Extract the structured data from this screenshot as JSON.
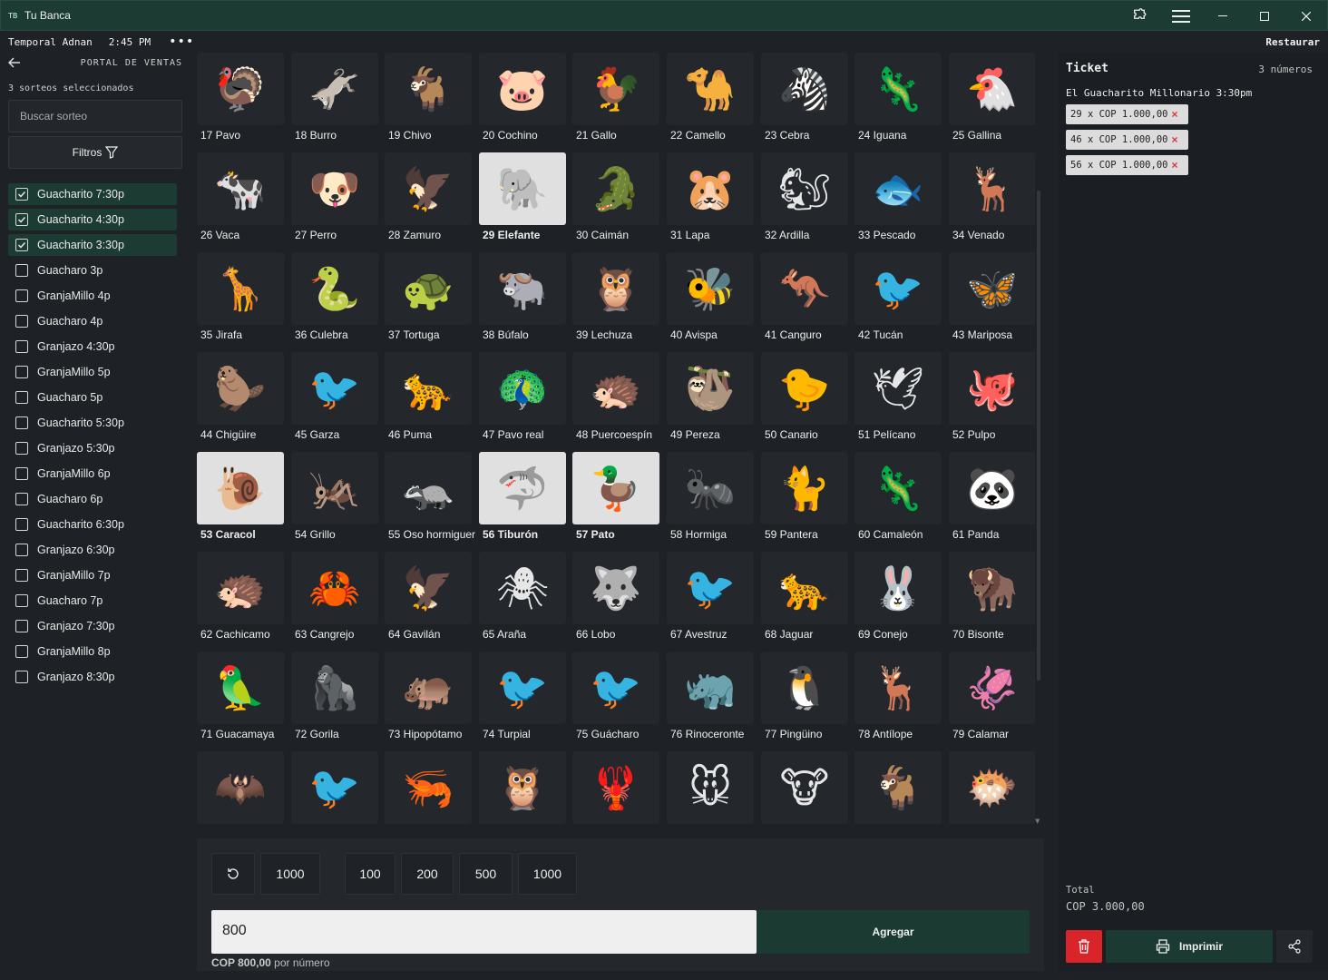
{
  "window": {
    "app_icon": "TB",
    "title": "Tu Banca"
  },
  "status": {
    "user": "Temporal Adnan",
    "time": "2:45 PM",
    "more": "•••",
    "restore": "Restaurar"
  },
  "sidebar": {
    "portal": "PORTAL DE VENTAS",
    "selected_count": "3 sorteos seleccionados",
    "search_placeholder": "Buscar sorteo",
    "filters": "Filtros",
    "draws": [
      {
        "label": "Guacharito 7:30p",
        "checked": true
      },
      {
        "label": "Guacharito 4:30p",
        "checked": true
      },
      {
        "label": "Guacharito 3:30p",
        "checked": true
      },
      {
        "label": "Guacharo 3p",
        "checked": false
      },
      {
        "label": "GranjaMillo 4p",
        "checked": false
      },
      {
        "label": "Guacharo 4p",
        "checked": false
      },
      {
        "label": "Granjazo 4:30p",
        "checked": false
      },
      {
        "label": "GranjaMillo 5p",
        "checked": false
      },
      {
        "label": "Guacharo 5p",
        "checked": false
      },
      {
        "label": "Guacharito 5:30p",
        "checked": false
      },
      {
        "label": "Granjazo 5:30p",
        "checked": false
      },
      {
        "label": "GranjaMillo 6p",
        "checked": false
      },
      {
        "label": "Guacharo 6p",
        "checked": false
      },
      {
        "label": "Guacharito 6:30p",
        "checked": false
      },
      {
        "label": "Granjazo 6:30p",
        "checked": false
      },
      {
        "label": "GranjaMillo 7p",
        "checked": false
      },
      {
        "label": "Guacharo 7p",
        "checked": false
      },
      {
        "label": "Granjazo 7:30p",
        "checked": false
      },
      {
        "label": "GranjaMillo 8p",
        "checked": false
      },
      {
        "label": "Granjazo 8:30p",
        "checked": false
      }
    ]
  },
  "animals": [
    {
      "label": "17 Pavo",
      "emoji": "🦃",
      "selected": false
    },
    {
      "label": "18 Burro",
      "emoji": "🫏",
      "selected": false
    },
    {
      "label": "19 Chivo",
      "emoji": "🐐",
      "selected": false
    },
    {
      "label": "20 Cochino",
      "emoji": "🐷",
      "selected": false
    },
    {
      "label": "21 Gallo",
      "emoji": "🐓",
      "selected": false
    },
    {
      "label": "22 Camello",
      "emoji": "🐪",
      "selected": false
    },
    {
      "label": "23 Cebra",
      "emoji": "🦓",
      "selected": false
    },
    {
      "label": "24 Iguana",
      "emoji": "🦎",
      "selected": false
    },
    {
      "label": "25 Gallina",
      "emoji": "🐔",
      "selected": false
    },
    {
      "label": "26 Vaca",
      "emoji": "🐄",
      "selected": false
    },
    {
      "label": "27 Perro",
      "emoji": "🐶",
      "selected": false
    },
    {
      "label": "28 Zamuro",
      "emoji": "🦅",
      "selected": false
    },
    {
      "label": "29 Elefante",
      "emoji": "🐘",
      "selected": true
    },
    {
      "label": "30 Caimán",
      "emoji": "🐊",
      "selected": false
    },
    {
      "label": "31 Lapa",
      "emoji": "🐹",
      "selected": false
    },
    {
      "label": "32 Ardilla",
      "emoji": "🐿",
      "selected": false
    },
    {
      "label": "33 Pescado",
      "emoji": "🐟",
      "selected": false
    },
    {
      "label": "34 Venado",
      "emoji": "🦌",
      "selected": false
    },
    {
      "label": "35 Jirafa",
      "emoji": "🦒",
      "selected": false
    },
    {
      "label": "36 Culebra",
      "emoji": "🐍",
      "selected": false
    },
    {
      "label": "37 Tortuga",
      "emoji": "🐢",
      "selected": false
    },
    {
      "label": "38 Búfalo",
      "emoji": "🐃",
      "selected": false
    },
    {
      "label": "39 Lechuza",
      "emoji": "🦉",
      "selected": false
    },
    {
      "label": "40 Avispa",
      "emoji": "🐝",
      "selected": false
    },
    {
      "label": "41 Canguro",
      "emoji": "🦘",
      "selected": false
    },
    {
      "label": "42 Tucán",
      "emoji": "🐦",
      "selected": false
    },
    {
      "label": "43 Mariposa",
      "emoji": "🦋",
      "selected": false
    },
    {
      "label": "44 Chigüire",
      "emoji": "🦫",
      "selected": false
    },
    {
      "label": "45 Garza",
      "emoji": "🐦",
      "selected": false
    },
    {
      "label": "46 Puma",
      "emoji": "🐆",
      "selected": false
    },
    {
      "label": "47 Pavo real",
      "emoji": "🦚",
      "selected": false
    },
    {
      "label": "48 Puercoespín",
      "emoji": "🦔",
      "selected": false
    },
    {
      "label": "49 Pereza",
      "emoji": "🦥",
      "selected": false
    },
    {
      "label": "50 Canario",
      "emoji": "🐤",
      "selected": false
    },
    {
      "label": "51 Pelícano",
      "emoji": "🕊",
      "selected": false
    },
    {
      "label": "52 Pulpo",
      "emoji": "🐙",
      "selected": false
    },
    {
      "label": "53 Caracol",
      "emoji": "🐌",
      "selected": true
    },
    {
      "label": "54 Grillo",
      "emoji": "🦗",
      "selected": false
    },
    {
      "label": "55 Oso hormiguero",
      "emoji": "🦡",
      "selected": false
    },
    {
      "label": "56 Tiburón",
      "emoji": "🦈",
      "selected": true
    },
    {
      "label": "57 Pato",
      "emoji": "🦆",
      "selected": true
    },
    {
      "label": "58 Hormiga",
      "emoji": "🐜",
      "selected": false
    },
    {
      "label": "59 Pantera",
      "emoji": "🐈",
      "selected": false
    },
    {
      "label": "60 Camaleón",
      "emoji": "🦎",
      "selected": false
    },
    {
      "label": "61 Panda",
      "emoji": "🐼",
      "selected": false
    },
    {
      "label": "62 Cachicamo",
      "emoji": "🦔",
      "selected": false
    },
    {
      "label": "63 Cangrejo",
      "emoji": "🦀",
      "selected": false
    },
    {
      "label": "64 Gavilán",
      "emoji": "🦅",
      "selected": false
    },
    {
      "label": "65 Araña",
      "emoji": "🕷",
      "selected": false
    },
    {
      "label": "66 Lobo",
      "emoji": "🐺",
      "selected": false
    },
    {
      "label": "67 Avestruz",
      "emoji": "🐦",
      "selected": false
    },
    {
      "label": "68 Jaguar",
      "emoji": "🐆",
      "selected": false
    },
    {
      "label": "69 Conejo",
      "emoji": "🐰",
      "selected": false
    },
    {
      "label": "70 Bisonte",
      "emoji": "🦬",
      "selected": false
    },
    {
      "label": "71 Guacamaya",
      "emoji": "🦜",
      "selected": false
    },
    {
      "label": "72 Gorila",
      "emoji": "🦍",
      "selected": false
    },
    {
      "label": "73 Hipopótamo",
      "emoji": "🦛",
      "selected": false
    },
    {
      "label": "74 Turpial",
      "emoji": "🐦",
      "selected": false
    },
    {
      "label": "75 Guácharo",
      "emoji": "🐦",
      "selected": false
    },
    {
      "label": "76 Rinoceronte",
      "emoji": "🦏",
      "selected": false
    },
    {
      "label": "77 Pingüino",
      "emoji": "🐧",
      "selected": false
    },
    {
      "label": "78 Antílope",
      "emoji": "🦌",
      "selected": false
    },
    {
      "label": "79 Calamar",
      "emoji": "🦑",
      "selected": false
    },
    {
      "label": "",
      "emoji": "🦇",
      "selected": false
    },
    {
      "label": "",
      "emoji": "🐦",
      "selected": false
    },
    {
      "label": "",
      "emoji": "🦐",
      "selected": false
    },
    {
      "label": "",
      "emoji": "🦉",
      "selected": false
    },
    {
      "label": "",
      "emoji": "🦞",
      "selected": false
    },
    {
      "label": "",
      "emoji": "🐭",
      "selected": false
    },
    {
      "label": "",
      "emoji": "🐮",
      "selected": false
    },
    {
      "label": "",
      "emoji": "🐐",
      "selected": false
    },
    {
      "label": "",
      "emoji": "🐡",
      "selected": false
    }
  ],
  "amount": {
    "reset_icon": "refresh-icon",
    "last": "1000",
    "quick": [
      "100",
      "200",
      "500",
      "1000"
    ],
    "value": "800",
    "add": "Agregar",
    "per_number_value": "COP 800,00",
    "per_number_suffix": " por número"
  },
  "ticket": {
    "title": "Ticket",
    "count": "3 números",
    "draw": "El Guacharito Millonario 3:30pm",
    "lines": [
      "29 x COP 1.000,00",
      "46 x COP 1.000,00",
      "56 x COP 1.000,00"
    ],
    "remove_glyph": "×",
    "total_label": "Total",
    "total_value": "COP 3.000,00",
    "print": "Imprimir"
  },
  "colors": {
    "accent": "#1b3b32",
    "danger": "#d9252a",
    "background": "#1e2125"
  }
}
